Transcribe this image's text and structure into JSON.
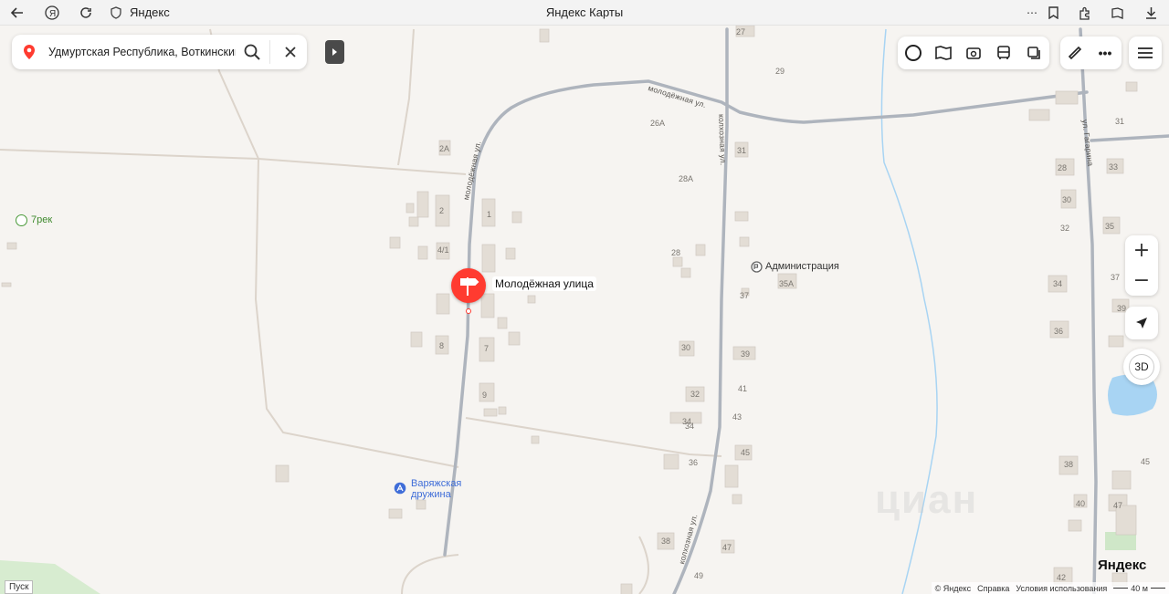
{
  "browser": {
    "site_name": "Яндекс",
    "page_title": "Яндекс Карты"
  },
  "search": {
    "query": "Удмуртская Республика, Воткинский"
  },
  "map": {
    "pin_label": "Молодёжная улица",
    "streets": {
      "molodezhnaya_north": "молодёжная ул.",
      "molodezhnaya_east": "молодёжная ул.",
      "kolkhoznaya_north": "колхозная ул.",
      "kolkhoznaya_south": "колхозная ул.",
      "gagarina": "ул. Гагарина"
    },
    "pois": {
      "park": "7рек",
      "administration": "Администрация",
      "varyazh": "Варяжская дружина"
    },
    "house_numbers": [
      "27",
      "29",
      "29",
      "26А",
      "31",
      "31",
      "2А",
      "28А",
      "28",
      "33",
      "2",
      "1",
      "30",
      "4/1",
      "28",
      "35",
      "32",
      "37",
      "34",
      "34",
      "37",
      "35А",
      "8",
      "7",
      "30",
      "39",
      "36",
      "36",
      "39",
      "9",
      "32",
      "41",
      "34",
      "43",
      "45",
      "38",
      "45",
      "40",
      "47",
      "38",
      "47",
      "49",
      "42"
    ]
  },
  "controls": {
    "zoom_in": "+",
    "zoom_out": "−",
    "view_3d": "3D"
  },
  "footer": {
    "pusk": "Пуск",
    "copyright": "© Яндекс",
    "help": "Справка",
    "terms": "Условия использования",
    "scale": "40 м",
    "logo": "Яндекс"
  },
  "colors": {
    "accent_red": "#ff3b30",
    "road_main": "#a9b0bb",
    "water": "#a8d4f3",
    "map_bg": "#f6f4f1"
  }
}
